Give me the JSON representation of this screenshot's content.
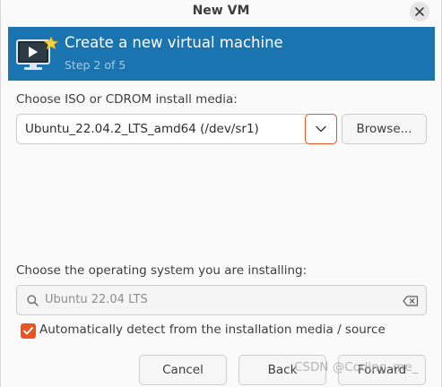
{
  "window": {
    "title": "New VM"
  },
  "banner": {
    "title": "Create a new virtual machine",
    "step": "Step 2 of 5"
  },
  "install_media": {
    "label": "Choose ISO or CDROM install media:",
    "selected": "Ubuntu_22.04.2_LTS_amd64 (/dev/sr1)",
    "browse_label": "Browse..."
  },
  "os": {
    "label": "Choose the operating system you are installing:",
    "search_value": "Ubuntu 22.04 LTS",
    "auto_detect_label": "Automatically detect from the installation media / source",
    "auto_detect_checked": true
  },
  "footer": {
    "cancel_label": "Cancel",
    "back_label": "Back",
    "forward_label": "Forward"
  },
  "watermark": "CSDN @Coding_me_",
  "colors": {
    "accent": "#e95420",
    "banner": "#1a74b0",
    "banner_subtitle": "#9fcaea"
  },
  "icons": {
    "close": "close-icon",
    "vm": "vm-display-icon",
    "dropdown": "chevron-down-icon",
    "search": "search-icon",
    "clear": "clear-input-icon",
    "checkbox": "checkmark-icon"
  }
}
